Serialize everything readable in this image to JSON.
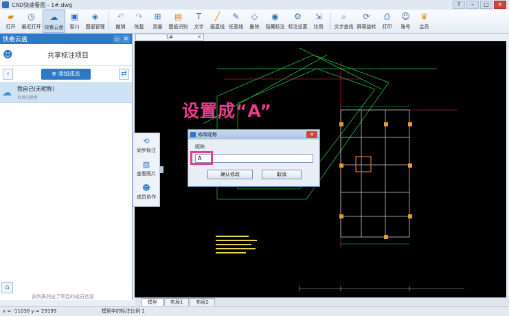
{
  "window": {
    "title": "CAD快速看图 - 1#.dwg",
    "controls": [
      "?",
      "–",
      "□",
      "✕"
    ]
  },
  "toolbar": {
    "buttons": [
      {
        "label": "打开",
        "icon": "folder-icon"
      },
      {
        "label": "最近打开",
        "icon": "clock-icon"
      },
      {
        "label": "快看云盘",
        "icon": "cloud-icon",
        "active": true
      },
      {
        "label": "窗口",
        "icon": "window-icon"
      },
      {
        "label": "图层管理",
        "icon": "layers-icon"
      },
      {
        "label": "撤销",
        "icon": "undo-icon"
      },
      {
        "label": "恢复",
        "icon": "redo-icon"
      },
      {
        "label": "测量",
        "icon": "ruler-icon"
      },
      {
        "label": "图纸识别",
        "icon": "scan-icon"
      },
      {
        "label": "文字",
        "icon": "text-icon"
      },
      {
        "label": "画直线",
        "icon": "line-icon"
      },
      {
        "label": "任意线",
        "icon": "pencil-icon"
      },
      {
        "label": "删除",
        "icon": "eraser-icon"
      },
      {
        "label": "隐藏标注",
        "icon": "eye-icon"
      },
      {
        "label": "标注设置",
        "icon": "gear-icon"
      },
      {
        "label": "比例",
        "icon": "scale-icon"
      },
      {
        "label": "文字查找",
        "icon": "find-text-icon"
      },
      {
        "label": "屏幕旋转",
        "icon": "rotate-screen-icon"
      },
      {
        "label": "打印",
        "icon": "printer-icon"
      },
      {
        "label": "账号",
        "icon": "user-icon"
      },
      {
        "label": "会员",
        "icon": "vip-icon"
      }
    ]
  },
  "panel": {
    "title": "快看云盘",
    "share_title": "共享标注项目",
    "add_member": "添加成员",
    "member": {
      "name": "我自己(无昵称)",
      "role": "项目创建者"
    },
    "footer_note": "该列表列出了项目的成员信息"
  },
  "side_strip": [
    {
      "label": "同步标注",
      "icon": "sync-icon"
    },
    {
      "label": "查看照片",
      "icon": "photo-icon"
    },
    {
      "label": "成员协作",
      "icon": "team-icon"
    }
  ],
  "document_tab": {
    "label": "1#"
  },
  "annotation": {
    "text": "设置成“A”"
  },
  "dialog": {
    "title": "修改昵称",
    "field_label": "昵称",
    "value": "A",
    "confirm": "确认修改",
    "cancel": "取消"
  },
  "layout_tabs": [
    "模型",
    "布局1",
    "布局2"
  ],
  "status": {
    "coords": "x = -11038  y = 29199",
    "scale": "模型中的标注比例 1"
  },
  "colors": {
    "accent": "#2b79c7",
    "annotation": "#e93d8c"
  }
}
